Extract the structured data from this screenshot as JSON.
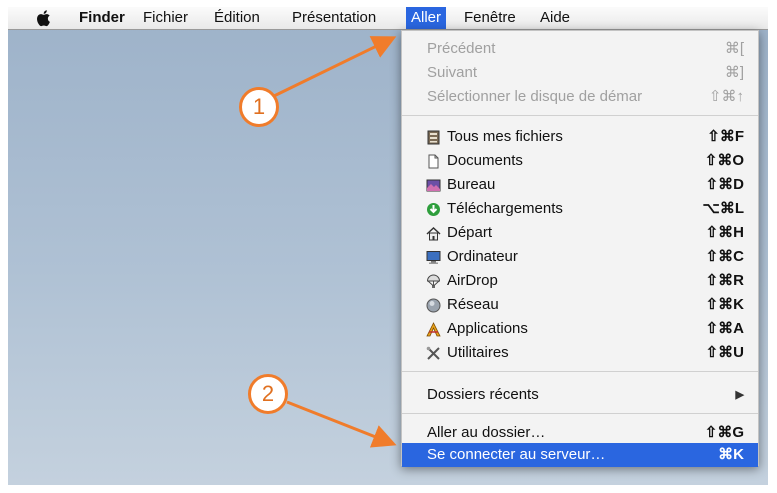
{
  "menubar": {
    "items": [
      {
        "label": "Finder"
      },
      {
        "label": "Fichier"
      },
      {
        "label": "Édition"
      },
      {
        "label": "Présentation"
      },
      {
        "label": "Aller"
      },
      {
        "label": "Fenêtre"
      },
      {
        "label": "Aide"
      }
    ],
    "active_item": "Aller"
  },
  "menu": {
    "items": [
      {
        "label": "Précédent",
        "shortcut": "⌘[",
        "enabled": false
      },
      {
        "label": "Suivant",
        "shortcut": "⌘]",
        "enabled": false
      },
      {
        "label": "Sélectionner le disque de démar",
        "shortcut": "⇧⌘↑",
        "enabled": false
      },
      {
        "label": "Tous mes fichiers",
        "shortcut": "⇧⌘F",
        "icon": "all-files-icon"
      },
      {
        "label": "Documents",
        "shortcut": "⇧⌘O",
        "icon": "documents-icon"
      },
      {
        "label": "Bureau",
        "shortcut": "⇧⌘D",
        "icon": "desktop-icon"
      },
      {
        "label": "Téléchargements",
        "shortcut": "⌥⌘L",
        "icon": "downloads-icon"
      },
      {
        "label": "Départ",
        "shortcut": "⇧⌘H",
        "icon": "home-icon"
      },
      {
        "label": "Ordinateur",
        "shortcut": "⇧⌘C",
        "icon": "computer-icon"
      },
      {
        "label": "AirDrop",
        "shortcut": "⇧⌘R",
        "icon": "airdrop-icon"
      },
      {
        "label": "Réseau",
        "shortcut": "⇧⌘K",
        "icon": "network-icon"
      },
      {
        "label": "Applications",
        "shortcut": "⇧⌘A",
        "icon": "applications-icon"
      },
      {
        "label": "Utilitaires",
        "shortcut": "⇧⌘U",
        "icon": "utilities-icon"
      },
      {
        "label": "Dossiers récents",
        "shortcut": "▶",
        "submenu": true
      },
      {
        "label": "Aller au dossier…",
        "shortcut": "⇧⌘G"
      },
      {
        "label": "Se connecter au serveur…",
        "shortcut": "⌘K",
        "highlighted": true
      }
    ]
  },
  "callouts": [
    {
      "number": "1"
    },
    {
      "number": "2"
    }
  ],
  "colors": {
    "highlight": "#2a66e0",
    "callout": "#f07c2b",
    "wallpaper_top": "#9db2c9"
  }
}
